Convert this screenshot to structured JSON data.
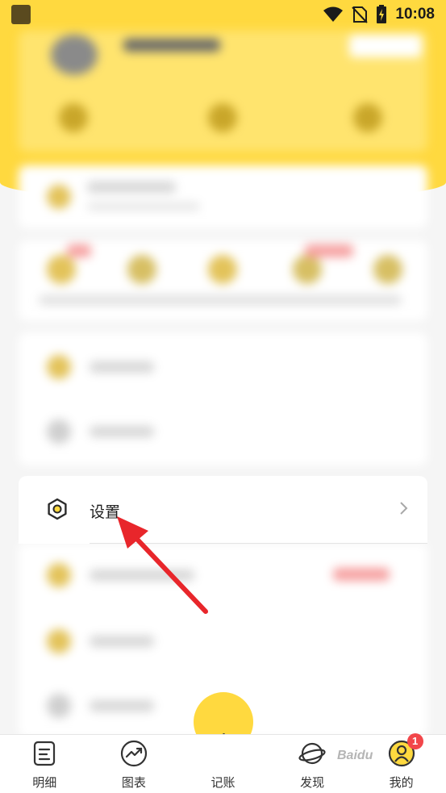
{
  "status_bar": {
    "time": "10:08"
  },
  "settings_row": {
    "label": "设置",
    "icon": "settings-hexagon-icon"
  },
  "bottom_nav": {
    "items": [
      {
        "label": "明细",
        "icon": "document-list-icon"
      },
      {
        "label": "图表",
        "icon": "trend-chart-icon"
      },
      {
        "label": "记账",
        "icon": "add-record-icon"
      },
      {
        "label": "发现",
        "icon": "planet-icon"
      },
      {
        "label": "我的",
        "icon": "user-profile-icon",
        "badge": "1"
      }
    ]
  },
  "watermark": "Baidu",
  "colors": {
    "header_yellow": "#ffd93f",
    "badge_red": "#f2464a",
    "annotation_red": "#e8262b"
  }
}
